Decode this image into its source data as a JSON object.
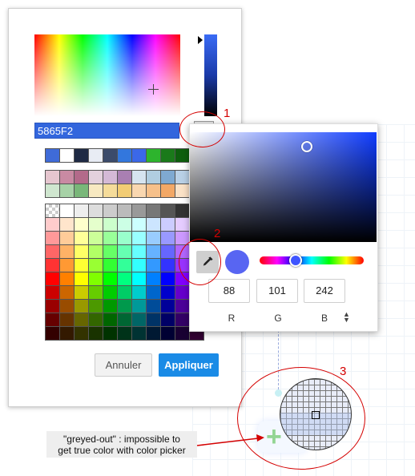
{
  "picker": {
    "hex_value": "5865F2",
    "cancel_label": "Annuler",
    "apply_label": "Appliquer",
    "palette_basic": [
      "#3f6bd8",
      "#ffffff",
      "#1f2a44",
      "#e8ecf4",
      "#3b4b6b",
      "#3377dd",
      "#3b68e8",
      "#2db42d",
      "#1a7a1a",
      "#0d5f0d",
      "#2fb82f"
    ],
    "palette_pastel_rows": [
      [
        "#e6c6cf",
        "#c98aa3",
        "#b36a8a",
        "#e3d0dd",
        "#d4b9d6",
        "#a97fb2",
        "#d6e4f0",
        "#b0cde0",
        "#7fa9d1",
        "#b9d0e6",
        "#dbe7f2"
      ],
      [
        "#cfe6cf",
        "#a7d2a7",
        "#79b779",
        "#f7e9c1",
        "#f5dc9a",
        "#f2cc74",
        "#f9d7b0",
        "#f6c08a",
        "#f3a866",
        "#fbe2c7",
        "#fde7b2"
      ]
    ],
    "palette_grid_rows": [
      [
        "checker",
        "#ffffff",
        "#eeeeee",
        "#dddddd",
        "#cccccc",
        "#bbbbbb",
        "#999999",
        "#777777",
        "#555555",
        "#333333",
        "#111111"
      ],
      [
        "#ffcccc",
        "#ffe5cc",
        "#ffffcc",
        "#e5ffcc",
        "#ccffcc",
        "#ccffe5",
        "#ccffff",
        "#cce5ff",
        "#ccccff",
        "#e5ccff",
        "#ffccff"
      ],
      [
        "#ff9999",
        "#ffcc99",
        "#ffff99",
        "#ccff99",
        "#99ff99",
        "#99ffcc",
        "#99ffff",
        "#99ccff",
        "#9999ff",
        "#cc99ff",
        "#ff99ff"
      ],
      [
        "#ff6666",
        "#ffb266",
        "#ffff66",
        "#b2ff66",
        "#66ff66",
        "#66ffb2",
        "#66ffff",
        "#66b2ff",
        "#6666ff",
        "#b266ff",
        "#ff66ff"
      ],
      [
        "#ff3333",
        "#ff9933",
        "#ffff33",
        "#99ff33",
        "#33ff33",
        "#33ff99",
        "#33ffff",
        "#3399ff",
        "#3333ff",
        "#9933ff",
        "#ff33ff"
      ],
      [
        "#ff0000",
        "#ff8000",
        "#ffff00",
        "#80ff00",
        "#00ff00",
        "#00ff80",
        "#00ffff",
        "#0080ff",
        "#0000ff",
        "#8000ff",
        "#ff00ff"
      ],
      [
        "#cc0000",
        "#cc6600",
        "#cccc00",
        "#66cc00",
        "#00cc00",
        "#00cc66",
        "#00cccc",
        "#0066cc",
        "#0000cc",
        "#6600cc",
        "#cc00cc"
      ],
      [
        "#990000",
        "#994c00",
        "#999900",
        "#4c9900",
        "#009900",
        "#00994c",
        "#009999",
        "#004c99",
        "#000099",
        "#4c0099",
        "#990099"
      ],
      [
        "#660000",
        "#663300",
        "#666600",
        "#336600",
        "#006600",
        "#006633",
        "#006666",
        "#003366",
        "#000066",
        "#330066",
        "#660066"
      ],
      [
        "#330000",
        "#331900",
        "#333300",
        "#193300",
        "#003300",
        "#003319",
        "#003333",
        "#001933",
        "#000033",
        "#190033",
        "#330033"
      ]
    ]
  },
  "popup": {
    "r_value": "88",
    "g_value": "101",
    "b_value": "242",
    "r_label": "R",
    "g_label": "G",
    "b_label": "B",
    "preview_color": "#5865f2",
    "mode_toggle_icon": "up-down-chevron-icon"
  },
  "annotations": {
    "marker_1": "1",
    "marker_2": "2",
    "marker_3": "3",
    "note_line1": "\"greyed-out\" : impossible to",
    "note_line2": "get true color with color picker",
    "accent_color": "#d40000"
  }
}
